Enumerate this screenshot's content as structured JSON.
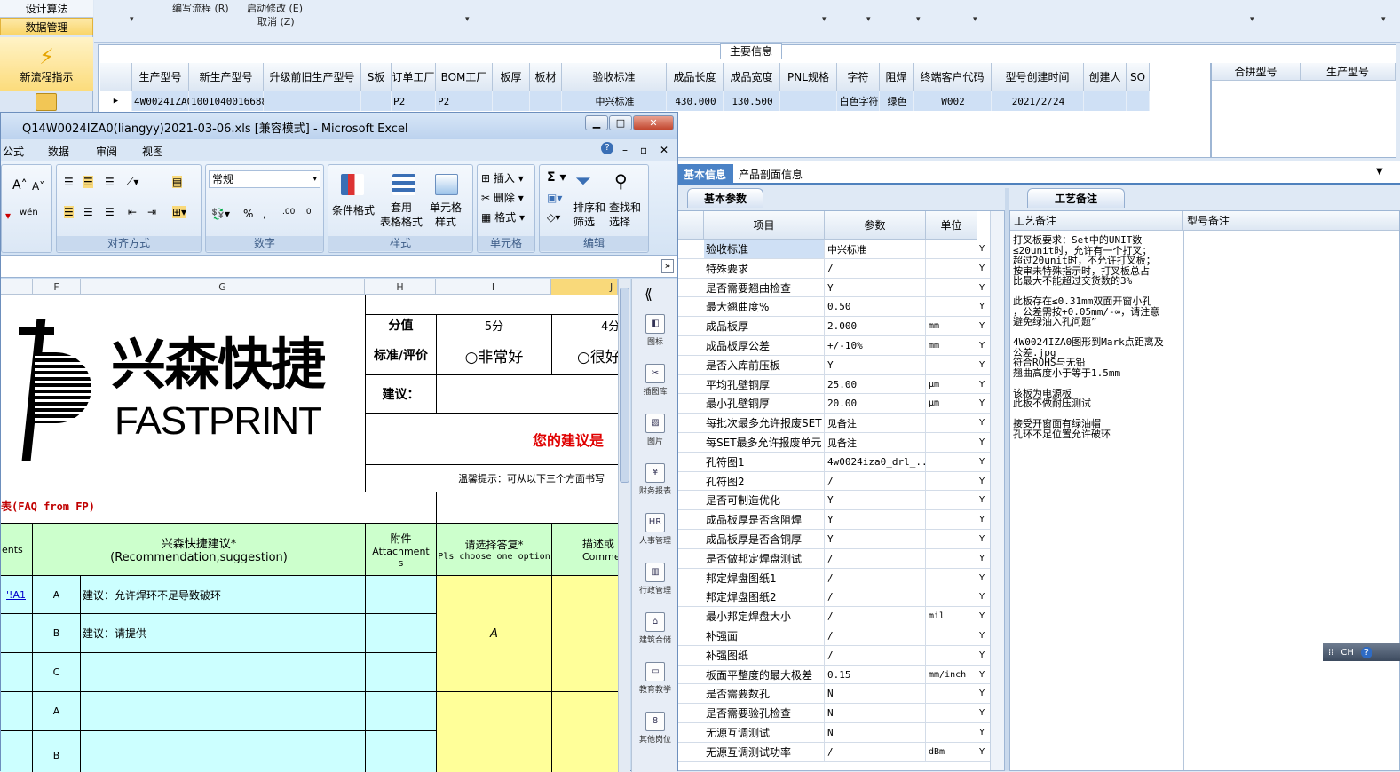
{
  "nav": {
    "design": "设计算法",
    "data": "数据管理",
    "flow": "新流程指示"
  },
  "toolbar": {
    "write_flow": "编写流程 (R)",
    "start_edit": "启动修改 (E)",
    "cancel": "取消 (Z)"
  },
  "main": {
    "title": "主要信息",
    "columns": [
      "生产型号",
      "新生产型号",
      "升级前旧生产型号",
      "S板",
      "订单工厂",
      "BOM工厂",
      "板厚",
      "板材",
      "验收标准",
      "成品长度",
      "成品宽度",
      "PNL规格",
      "字符",
      "阻焊",
      "终端客户代码",
      "型号创建时间",
      "创建人",
      "SO"
    ],
    "row": [
      "4W0024IZA0",
      "10010400166882",
      "",
      "",
      "P2",
      "P2",
      "",
      "",
      "中兴标准",
      "430.000",
      "130.500",
      "",
      "白色字符",
      "绿色",
      "W002",
      "2021/2/24",
      "",
      ""
    ],
    "right_columns": [
      "合拼型号",
      "生产型号"
    ]
  },
  "tabs": {
    "basic": "基本信息",
    "section": "产品剖面信息"
  },
  "params": {
    "subtab": "基本参数",
    "headers": {
      "item": "项目",
      "param": "参数",
      "unit": "单位"
    },
    "rows": [
      {
        "item": "验收标准",
        "value": "中兴标准",
        "unit": "",
        "flag": "Y"
      },
      {
        "item": "特殊要求",
        "value": "/",
        "unit": "",
        "flag": "Y"
      },
      {
        "item": "是否需要翘曲检查",
        "value": "Y",
        "unit": "",
        "flag": "Y"
      },
      {
        "item": "最大翘曲度%",
        "value": "0.50",
        "unit": "",
        "flag": "Y"
      },
      {
        "item": "成品板厚",
        "value": "2.000",
        "unit": "mm",
        "flag": "Y"
      },
      {
        "item": "成品板厚公差",
        "value": "+/-10%",
        "unit": "mm",
        "flag": "Y"
      },
      {
        "item": "是否入库前压板",
        "value": "Y",
        "unit": "",
        "flag": "Y"
      },
      {
        "item": "平均孔壁铜厚",
        "value": "25.00",
        "unit": "μm",
        "flag": "Y"
      },
      {
        "item": "最小孔壁铜厚",
        "value": "20.00",
        "unit": "μm",
        "flag": "Y"
      },
      {
        "item": "每批次最多允许报废SET",
        "value": "见备注",
        "unit": "",
        "flag": "Y"
      },
      {
        "item": "每SET最多允许报废单元",
        "value": "见备注",
        "unit": "",
        "flag": "Y"
      },
      {
        "item": "孔符图1",
        "value": "4w0024iza0_drl_...",
        "unit": "",
        "flag": "Y"
      },
      {
        "item": "孔符图2",
        "value": "/",
        "unit": "",
        "flag": "Y"
      },
      {
        "item": "是否可制造优化",
        "value": "Y",
        "unit": "",
        "flag": "Y"
      },
      {
        "item": "成品板厚是否含阻焊",
        "value": "Y",
        "unit": "",
        "flag": "Y"
      },
      {
        "item": "成品板厚是否含铜厚",
        "value": "Y",
        "unit": "",
        "flag": "Y"
      },
      {
        "item": "是否做邦定焊盘测试",
        "value": "/",
        "unit": "",
        "flag": "Y"
      },
      {
        "item": "邦定焊盘图纸1",
        "value": "/",
        "unit": "",
        "flag": "Y"
      },
      {
        "item": "邦定焊盘图纸2",
        "value": "/",
        "unit": "",
        "flag": "Y"
      },
      {
        "item": "最小邦定焊盘大小",
        "value": "/",
        "unit": "mil",
        "flag": "Y"
      },
      {
        "item": "补强面",
        "value": "/",
        "unit": "",
        "flag": "Y"
      },
      {
        "item": "补强图纸",
        "value": "/",
        "unit": "",
        "flag": "Y"
      },
      {
        "item": "板面平整度的最大极差",
        "value": "0.15",
        "unit": "mm/inch",
        "flag": "Y"
      },
      {
        "item": "是否需要数孔",
        "value": "N",
        "unit": "",
        "flag": "Y"
      },
      {
        "item": "是否需要验孔检查",
        "value": "N",
        "unit": "",
        "flag": "Y"
      },
      {
        "item": "无源互调测试",
        "value": "N",
        "unit": "",
        "flag": "Y"
      },
      {
        "item": "无源互调测试功率",
        "value": "/",
        "unit": "dBm",
        "flag": "Y"
      }
    ]
  },
  "notes": {
    "subtab": "工艺备注",
    "col_process": "工艺备注",
    "col_model": "型号备注",
    "text": "打叉板要求：Set中的UNIT数\n≤20unit时，允许有一个打叉；\n超过20unit时，不允许打叉板；\n按审未特殊指示时，打叉板总占\n比最大不能超过交货数的3%\n\n此板存在≤0.31mm双面开窗小孔\n，公差需按+0.05mm/-∞，请注意\n避免绿油入孔问题”\n\n4W0024IZA0图形到Mark点距离及\n公差.jpg\n符合ROHS与无铅\n翘曲高度小于等于1.5mm\n\n该板为电源板\n此板不做耐压测试\n\n接受开窗面有绿油帽\n孔环不足位置允许破环"
  },
  "excel": {
    "title": "Q14W0024IZA0(liangyy)2021-03-06.xls  [兼容模式] - Microsoft Excel",
    "menu": [
      "公式",
      "数据",
      "审阅",
      "视图"
    ],
    "ribbon": {
      "groups": [
        "对齐方式",
        "数字",
        "样式",
        "单元格",
        "编辑"
      ],
      "number_format": "常规",
      "cond_format": "条件格式",
      "table_format": "套用\n表格格式",
      "cell_style": "单元格\n样式",
      "insert": "插入",
      "delete": "删除",
      "format": "格式",
      "sort": "排序和\n筛选",
      "find": "查找和\n选择"
    },
    "columns": [
      "F",
      "G",
      "H",
      "I",
      "J"
    ],
    "logo_cn": "兴森快捷",
    "logo_en": "FASTPRINT",
    "score_label": "分值",
    "score_5": "5分",
    "score_4": "4分",
    "criteria_label": "标准/评价",
    "opt_very_good": "○非常好",
    "opt_good": "○很好",
    "suggest_label": "建议：",
    "welcome": "您的建议是",
    "tip": "温馨提示：可从以下三个方面书写",
    "faq": "表(FAQ from FP)",
    "col_reco": "兴森快捷建议*",
    "col_reco_en": "(Recommendation,suggestion)",
    "col_attach": "附件",
    "col_attach_en": "Attachment\ns",
    "col_choose": "请选择答复*",
    "col_choose_en": "Pls choose one option",
    "col_desc": "描述或",
    "col_desc_en": "Comme",
    "col_comments": "ents",
    "link_cell": "'!A1",
    "row_a": "A",
    "row_b": "B",
    "row_c": "C",
    "row_a2": "A",
    "row_b2": "B",
    "sug_a": "建议：允许焊环不足导致破环",
    "sug_b": "建议：请提供",
    "answer": "A",
    "sidebar": [
      "图标",
      "插图库",
      "图片",
      "财务报表",
      "人事管理",
      "行政管理",
      "建筑合储",
      "教育教学",
      "其他岗位"
    ]
  },
  "ime": "CH"
}
